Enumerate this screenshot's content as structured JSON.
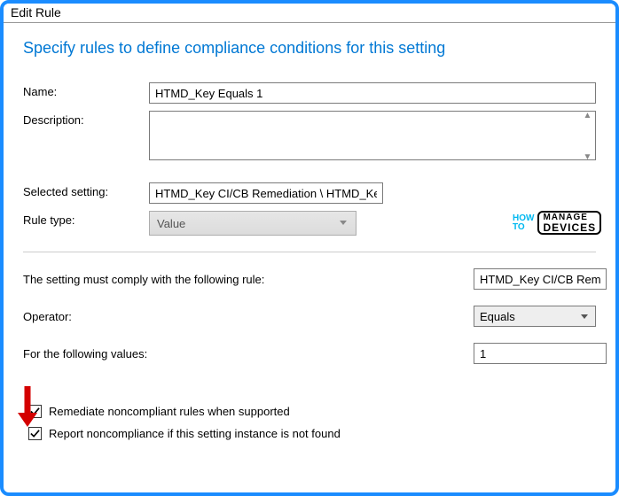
{
  "window": {
    "title": "Edit Rule"
  },
  "heading": "Specify rules to define compliance conditions for this setting",
  "form": {
    "name_label": "Name:",
    "name_value": "HTMD_Key Equals 1",
    "description_label": "Description:",
    "description_value": "",
    "selected_setting_label": "Selected setting:",
    "selected_setting_value": "HTMD_Key CI/CB Remediation \\ HTMD_Key",
    "rule_type_label": "Rule type:",
    "rule_type_value": "Value"
  },
  "rule": {
    "comply_label": "The setting must comply with the following rule:",
    "comply_value": "HTMD_Key CI/CB Remediation",
    "operator_label": "Operator:",
    "operator_value": "Equals",
    "values_label": "For the following values:",
    "values_value": "1"
  },
  "checks": {
    "remediate_label": "Remediate noncompliant rules when supported",
    "remediate_checked": true,
    "report_label": "Report noncompliance if this setting instance is not found",
    "report_checked": true
  },
  "watermark": {
    "line1": "HOW",
    "line2": "TO",
    "box1": "MANAGE",
    "box2": "DEVICES"
  }
}
